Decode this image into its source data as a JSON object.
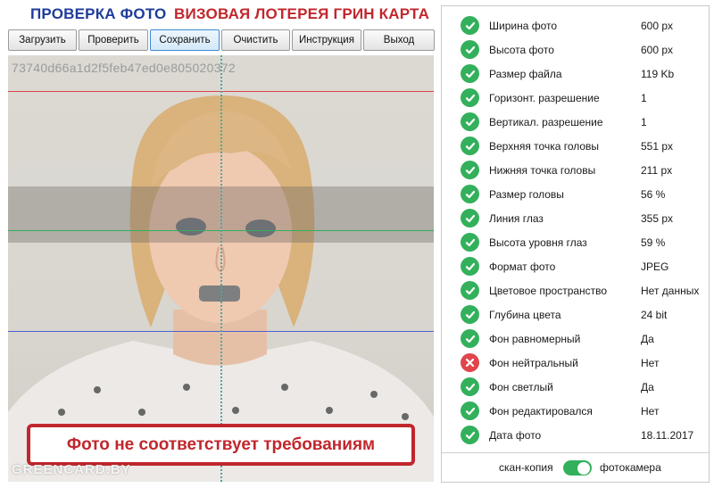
{
  "header": {
    "title_left": "ПРОВЕРКА ФОТО",
    "title_right": "ВИЗОВАЯ ЛОТЕРЕЯ ГРИН КАРТА"
  },
  "toolbar": {
    "load": "Загрузить",
    "check": "Проверить",
    "save": "Сохранить",
    "clear": "Очистить",
    "help": "Инструкция",
    "exit": "Выход"
  },
  "photo": {
    "id": "73740d66a1d2f5feb47ed0e805020372",
    "warning": "Фото не соответствует требованиям",
    "watermark": "GREENCARD.BY"
  },
  "results": [
    {
      "label": "Ширина фото",
      "value": "600 px",
      "status": "ok"
    },
    {
      "label": "Высота фото",
      "value": "600 px",
      "status": "ok"
    },
    {
      "label": "Размер файла",
      "value": "119 Kb",
      "status": "ok"
    },
    {
      "label": "Горизонт. разрешение",
      "value": "1",
      "status": "ok"
    },
    {
      "label": "Вертикал. разрешение",
      "value": "1",
      "status": "ok"
    },
    {
      "label": "Верхняя точка головы",
      "value": "551 px",
      "status": "ok"
    },
    {
      "label": "Нижняя точка головы",
      "value": "211 px",
      "status": "ok"
    },
    {
      "label": "Размер головы",
      "value": "56 %",
      "status": "ok"
    },
    {
      "label": "Линия глаз",
      "value": "355 px",
      "status": "ok"
    },
    {
      "label": "Высота уровня глаз",
      "value": "59 %",
      "status": "ok"
    },
    {
      "label": "Формат фото",
      "value": "JPEG",
      "status": "ok"
    },
    {
      "label": "Цветовое пространство",
      "value": "Нет данных",
      "status": "ok"
    },
    {
      "label": "Глубина цвета",
      "value": "24 bit",
      "status": "ok"
    },
    {
      "label": "Фон равномерный",
      "value": "Да",
      "status": "ok"
    },
    {
      "label": "Фон нейтральный",
      "value": "Нет",
      "status": "fail"
    },
    {
      "label": "Фон светлый",
      "value": "Да",
      "status": "ok"
    },
    {
      "label": "Фон редактировался",
      "value": "Нет",
      "status": "ok"
    },
    {
      "label": "Дата фото",
      "value": "18.11.2017",
      "status": "ok"
    }
  ],
  "mode_switch": {
    "left_label": "скан-копия",
    "right_label": "фотокамера",
    "state": "фотокамера"
  },
  "colors": {
    "title_blue": "#1f3d99",
    "title_red": "#c1272d",
    "ok": "#33b05c",
    "fail": "#e0454c"
  },
  "icons": {
    "ok": "check-circle-icon",
    "fail": "cross-circle-icon"
  }
}
